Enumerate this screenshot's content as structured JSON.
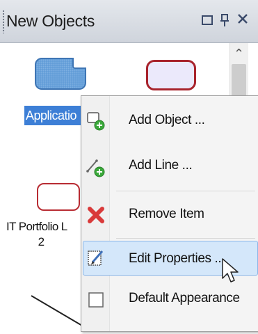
{
  "panel": {
    "title": "New Objects"
  },
  "items": {
    "application_label": "Applicatio",
    "it_portfolio_label_line1": "IT Portfolio L",
    "it_portfolio_label_line2": "2"
  },
  "context_menu": {
    "items": [
      {
        "label": "Add Object ...",
        "icon": "add-object-icon"
      },
      {
        "label": "Add Line ...",
        "icon": "add-line-icon"
      },
      {
        "label": "Remove Item",
        "icon": "remove-icon"
      },
      {
        "label": "Edit Properties ...",
        "icon": "edit-properties-icon"
      },
      {
        "label": "Default Appearance",
        "icon": "default-appearance-icon"
      }
    ],
    "highlighted_index": 3
  },
  "colors": {
    "selection": "#3d7fd6",
    "highlight": "#d4e7fa",
    "remove_red": "#d93a3a",
    "add_green": "#3aa83a"
  }
}
